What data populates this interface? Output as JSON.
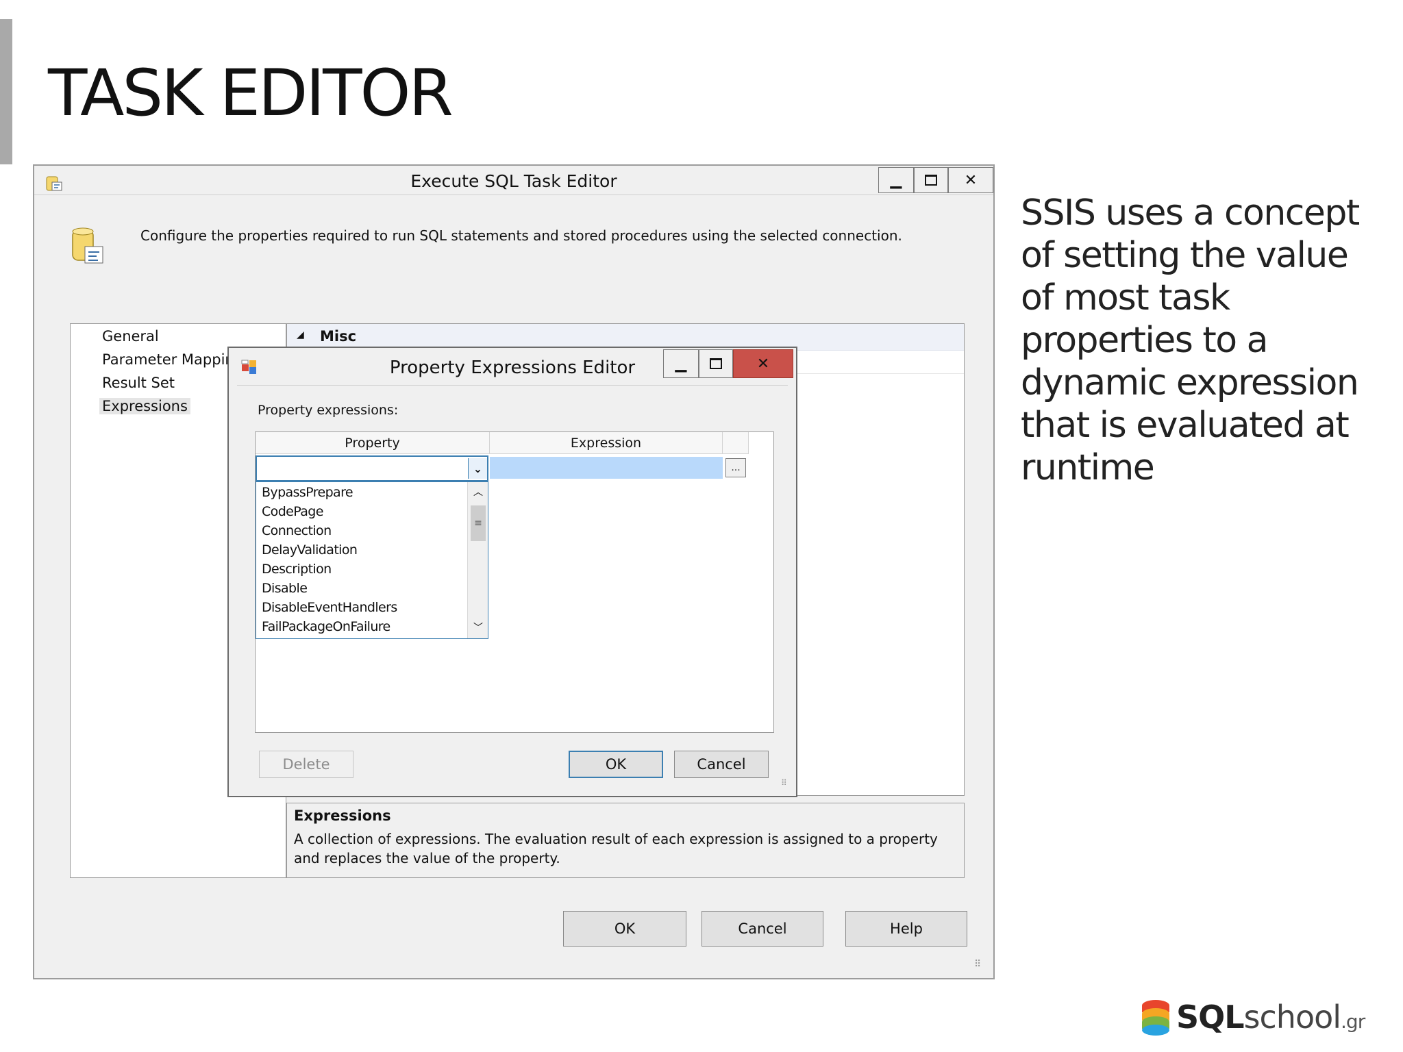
{
  "slide": {
    "title": "TASK EDITOR",
    "body": "SSIS uses a concept of setting the value of most task properties to a dynamic expression that is evaluated at runtime"
  },
  "main_window": {
    "title": "Execute SQL Task Editor",
    "header_description": "Configure the properties required to run SQL statements and stored procedures using the selected connection.",
    "nav_items": [
      "General",
      "Parameter Mappin",
      "Result Set",
      "Expressions"
    ],
    "selected_nav": "Expressions",
    "property_group": "Misc",
    "description_title": "Expressions",
    "description_text": "A collection of expressions. The evaluation result of each expression is assigned to a property and replaces the value of the property.",
    "buttons": {
      "ok": "OK",
      "cancel": "Cancel",
      "help": "Help"
    }
  },
  "dialog": {
    "title": "Property Expressions Editor",
    "label": "Property expressions:",
    "columns": [
      "Property",
      "Expression"
    ],
    "combo_value": "",
    "dropdown_options": [
      "BypassPrepare",
      "CodePage",
      "Connection",
      "DelayValidation",
      "Description",
      "Disable",
      "DisableEventHandlers",
      "FailPackageOnFailure"
    ],
    "ellipsis": "...",
    "buttons": {
      "delete": "Delete",
      "ok": "OK",
      "cancel": "Cancel"
    }
  },
  "logo": {
    "bold": "SQL",
    "rest": "school",
    "suffix": ".gr"
  },
  "colors": {
    "close_button": "#c9514a",
    "selection_highlight": "#b9d9fb",
    "focus_border": "#3c7fb1"
  }
}
